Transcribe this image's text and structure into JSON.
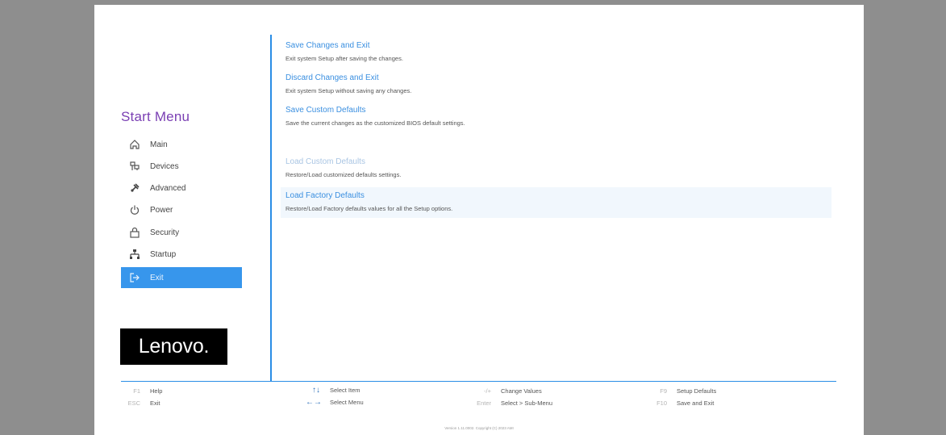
{
  "sidebar": {
    "title": "Start Menu",
    "items": [
      {
        "label": "Main",
        "icon": "home-icon"
      },
      {
        "label": "Devices",
        "icon": "devices-icon"
      },
      {
        "label": "Advanced",
        "icon": "advanced-icon"
      },
      {
        "label": "Power",
        "icon": "power-icon"
      },
      {
        "label": "Security",
        "icon": "lock-icon"
      },
      {
        "label": "Startup",
        "icon": "startup-icon"
      },
      {
        "label": "Exit",
        "icon": "exit-icon",
        "active": true
      }
    ],
    "logo": "Lenovo."
  },
  "options": [
    {
      "title": "Save Changes and Exit",
      "desc": "Exit system Setup after saving the changes."
    },
    {
      "title": "Discard Changes and Exit",
      "desc": "Exit system Setup without saving any changes."
    },
    {
      "title": "Save Custom Defaults",
      "desc": "Save the current changes as the customized BIOS default settings."
    },
    {
      "title": "Load Custom Defaults",
      "desc": "Restore/Load customized defaults settings.",
      "disabled": true
    },
    {
      "title": "Load Factory Defaults",
      "desc": "Restore/Load Factory defaults values for all the Setup options.",
      "selected": true
    }
  ],
  "footer": {
    "keys": [
      {
        "key": "F1",
        "label": "Help"
      },
      {
        "key": "ESC",
        "label": "Exit"
      },
      {
        "key": "↑↓",
        "label": "Select Item"
      },
      {
        "key": "←→",
        "label": "Select Menu"
      },
      {
        "key": "-/+",
        "label": "Change Values"
      },
      {
        "key": "Enter",
        "label": "Select > Sub-Menu"
      },
      {
        "key": "F9",
        "label": "Setup Defaults"
      },
      {
        "key": "F10",
        "label": "Save and Exit"
      }
    ],
    "version": "Version 1.11.0002. Copyright (C) 2023 AMI"
  },
  "colors": {
    "accent": "#3796ec",
    "title_purple": "#7a3fb3",
    "option_blue": "#3a8fe0"
  }
}
